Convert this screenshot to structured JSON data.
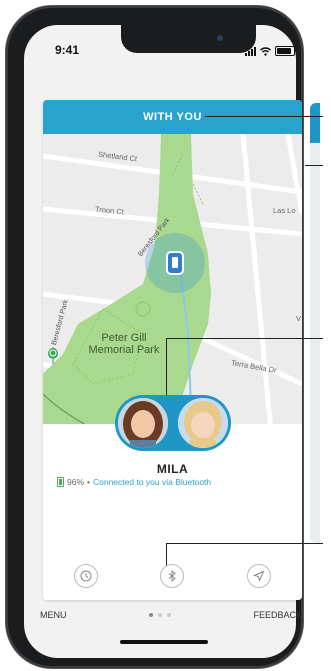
{
  "status_bar": {
    "time": "9:41"
  },
  "header": {
    "title": "WITH YOU"
  },
  "map": {
    "streets": [
      "Shetland Ct",
      "Troon Ct",
      "Beresford Park",
      "Las Lo",
      "Beresford Park",
      "Terra Bella Dr",
      "V"
    ],
    "park_label_line1": "Peter Gill",
    "park_label_line2": "Memorial Park"
  },
  "device": {
    "name": "MILA",
    "battery": "96%",
    "separator": "•",
    "connection": "Connected to you via Bluetooth"
  },
  "toolbar": {
    "history_icon": "history-icon",
    "bluetooth_icon": "bluetooth-icon",
    "navigate_icon": "navigate-icon"
  },
  "bottom_nav": {
    "menu": "MENU",
    "feedback": "FEEDBACK"
  },
  "colors": {
    "accent": "#29a3cd",
    "park": "#a9d98f",
    "map_bg": "#ececec"
  }
}
